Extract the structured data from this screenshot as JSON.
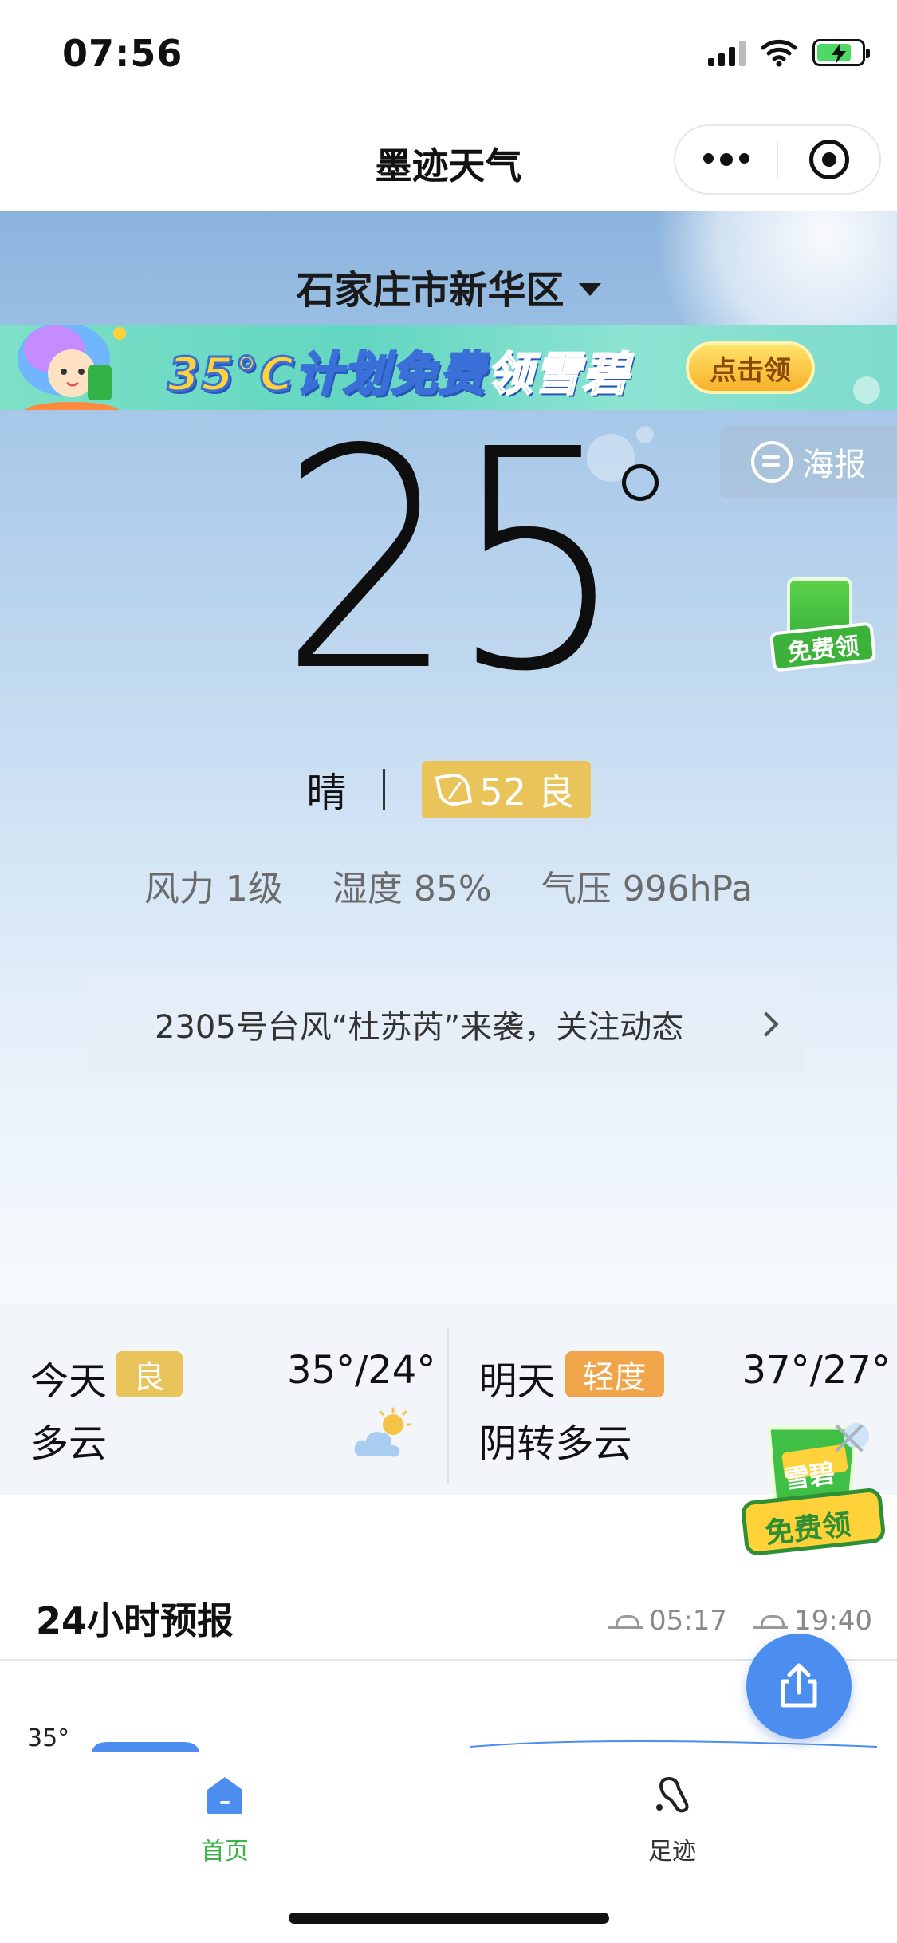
{
  "status_bar": {
    "time": "07:56"
  },
  "nav": {
    "title": "墨迹天气"
  },
  "hero": {
    "location": "石家庄市新华区",
    "promo": {
      "text_a": "35°C计划",
      "text_b": "免费",
      "text_c": "领雪碧",
      "button": "点击领"
    },
    "poster_label": "海报",
    "temperature": "25",
    "free_cup_label": "免费领",
    "condition": "晴",
    "aqi": {
      "value": "52 良",
      "color": "#e8c45a"
    },
    "metrics": [
      {
        "label": "风力 1级"
      },
      {
        "label": "湿度 85%"
      },
      {
        "label": "气压 996hPa"
      }
    ],
    "alert": "2305号台风“杜苏芮”来袭，关注动态"
  },
  "daily": {
    "today": {
      "name": "今天",
      "badge": "良",
      "badge_color": "#e8c45a",
      "temp": "35°/24°",
      "condition": "多云",
      "icon": "cloud-sun-icon"
    },
    "tomorrow": {
      "name": "明天",
      "badge": "轻度",
      "badge_color": "#f0a54a",
      "temp": "37°/27°",
      "condition": "阴转多云"
    }
  },
  "float_promo": {
    "brand": "雪碧",
    "label": "免费领"
  },
  "forecast": {
    "title": "24小时预报",
    "sunrise": "05:17",
    "sunset": "19:40",
    "axis_top": "35°"
  },
  "tabs": [
    {
      "label": "首页",
      "active": true,
      "color": "#3db34a"
    },
    {
      "label": "足迹",
      "active": false,
      "color": "#333333"
    }
  ],
  "colors": {
    "accent": "#4c8df0",
    "tab_active": "#3db34a"
  }
}
